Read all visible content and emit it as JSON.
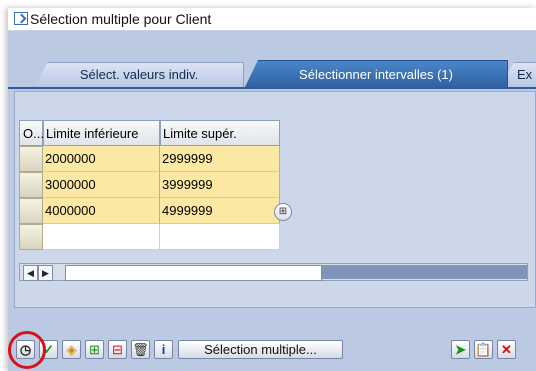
{
  "window": {
    "title": "Sélection multiple pour Client"
  },
  "tabs": [
    {
      "label": "Sélect. valeurs indiv."
    },
    {
      "label": "Sélectionner intervalles (1)"
    },
    {
      "label": "Ex"
    }
  ],
  "table": {
    "columns": [
      "O...",
      "Limite inférieure",
      "Limite supér."
    ],
    "rows": [
      {
        "low": "2000000",
        "high": "2999999"
      },
      {
        "low": "3000000",
        "high": "3999999"
      },
      {
        "low": "4000000",
        "high": "4999999"
      },
      {
        "low": "",
        "high": ""
      }
    ]
  },
  "toolbar": {
    "buttons": [
      "clock-icon",
      "check-icon",
      "options-icon",
      "insert-row-icon",
      "delete-row-icon",
      "trash-icon",
      "info-icon"
    ],
    "multiple_selection_label": "Sélection multiple...",
    "right_buttons": [
      "upload-icon",
      "clipboard-icon",
      "cancel-icon"
    ]
  },
  "colors": {
    "accent": "#2d5f9f",
    "grid_fill": "#fbe8a2",
    "highlight": "#d6111a"
  }
}
